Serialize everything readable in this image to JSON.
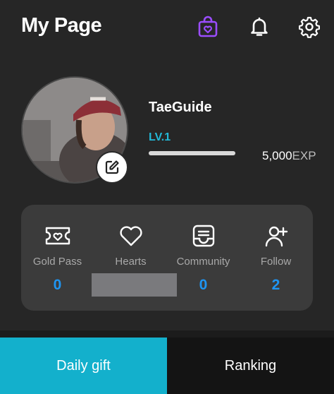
{
  "header": {
    "title": "My Page",
    "icons": [
      "shopping-bag-heart-icon",
      "bell-icon",
      "gear-icon"
    ],
    "accent_shop": "#9b4dff"
  },
  "profile": {
    "username": "TaeGuide",
    "level": "LV.1",
    "exp_value": "5,000",
    "exp_unit": "EXP",
    "exp_progress": 1.0,
    "level_color": "#22b9d8"
  },
  "stats": {
    "value_color": "#1f95f2",
    "items": [
      {
        "label": "Gold Pass",
        "value": "0",
        "icon": "ticket-heart-icon"
      },
      {
        "label": "Hearts",
        "value": "",
        "icon": "heart-icon"
      },
      {
        "label": "Community",
        "value": "0",
        "icon": "inbox-icon"
      },
      {
        "label": "Follow",
        "value": "2",
        "icon": "add-user-icon"
      }
    ]
  },
  "tabs": [
    {
      "label": "Daily gift",
      "active": true,
      "color": "#13b0cc"
    },
    {
      "label": "Ranking",
      "active": false
    }
  ]
}
